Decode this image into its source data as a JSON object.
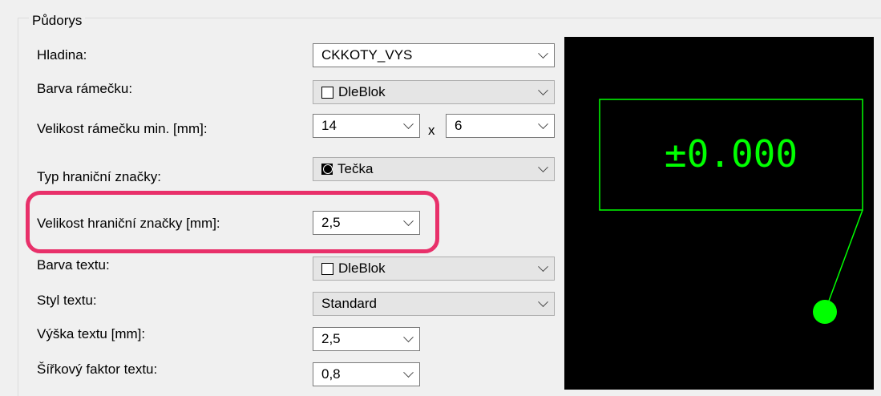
{
  "group": {
    "title": "Půdorys"
  },
  "fields": {
    "hladina": {
      "label": "Hladina:",
      "value": "CKKOTY_VYS"
    },
    "barva_ramecku": {
      "label": "Barva rámečku:",
      "value": "DleBlok"
    },
    "velikost_ramecku": {
      "label": "Velikost rámečku min. [mm]:",
      "value_w": "14",
      "separator": "x",
      "value_h": "6"
    },
    "typ_znacky": {
      "label": "Typ hraniční značky:",
      "value": "Tečka"
    },
    "velikost_znacky": {
      "label": "Velikost hraniční značky [mm]:",
      "value": "2,5"
    },
    "barva_textu": {
      "label": "Barva textu:",
      "value": "DleBlok"
    },
    "styl_textu": {
      "label": "Styl textu:",
      "value": "Standard"
    },
    "vyska_textu": {
      "label": "Výška textu [mm]:",
      "value": "2,5"
    },
    "sirkovy_faktor": {
      "label": "Šířkový faktor textu:",
      "value": "0,8"
    }
  },
  "preview": {
    "text": "±0.000",
    "line_color": "#00ff00",
    "background": "#000000"
  },
  "icons": {
    "dropdown": "chevron-down-icon",
    "color_swatch": "color-swatch-icon",
    "marker": "dot-marker-icon"
  },
  "highlight_color": "#e8306a"
}
